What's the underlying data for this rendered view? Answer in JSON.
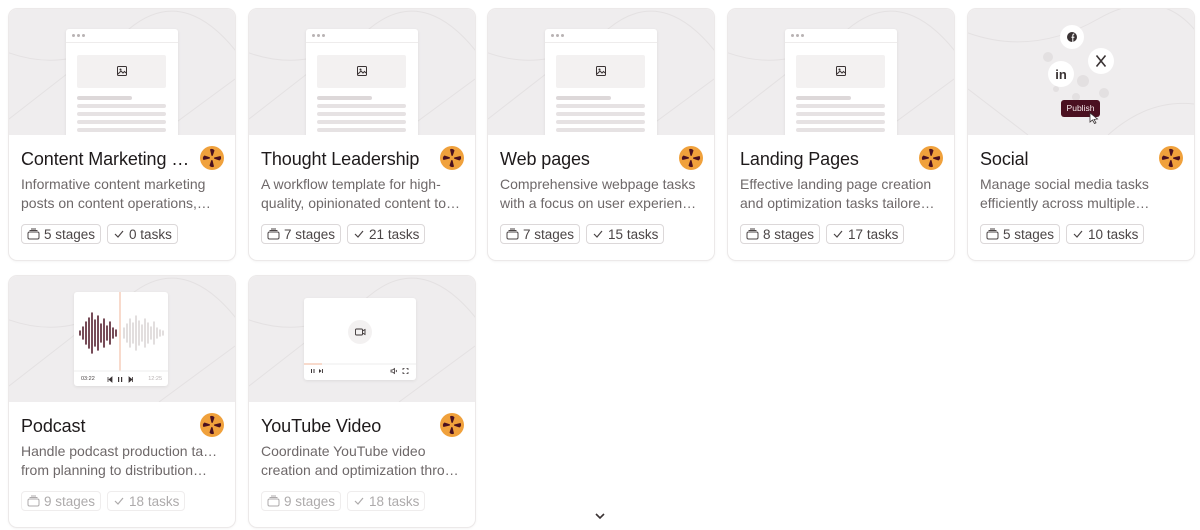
{
  "cards": [
    {
      "title": "Content Marketing …",
      "desc": [
        "Informative content marketing",
        "posts on content operations,…"
      ],
      "stages": "5 stages",
      "tasks": "0 tasks",
      "thumb": "document"
    },
    {
      "title": "Thought Leadership",
      "desc": [
        "A workflow template for high-",
        "quality, opinionated content to…"
      ],
      "stages": "7 stages",
      "tasks": "21 tasks",
      "thumb": "document"
    },
    {
      "title": "Web pages",
      "desc": [
        "Comprehensive webpage tasks",
        "with a focus on user experience…"
      ],
      "stages": "7 stages",
      "tasks": "15 tasks",
      "thumb": "document"
    },
    {
      "title": "Landing Pages",
      "desc": [
        "Effective landing page creation",
        "and optimization tasks tailored f…"
      ],
      "stages": "8 stages",
      "tasks": "17 tasks",
      "thumb": "document"
    },
    {
      "title": "Social",
      "desc": [
        "Manage social media tasks",
        "efficiently across multiple…"
      ],
      "stages": "5 stages",
      "tasks": "10 tasks",
      "thumb": "social",
      "publish_label": "Publish"
    },
    {
      "title": "Podcast",
      "desc": [
        "Handle podcast production tasks",
        "from planning to distribution…"
      ],
      "stages": "9 stages",
      "tasks": "18 tasks",
      "thumb": "podcast",
      "time_start": "03:22",
      "time_end": "12:25"
    },
    {
      "title": "YouTube Video",
      "desc": [
        "Coordinate YouTube video",
        "creation and optimization throu…"
      ],
      "stages": "9 stages",
      "tasks": "18 tasks",
      "thumb": "video"
    }
  ],
  "icons": {
    "stages": "stack-icon",
    "tasks": "check-icon",
    "logo": "brand-flower-icon",
    "scroll": "chevron-down-icon"
  },
  "colors": {
    "logo_bg": "#f0a13c",
    "logo_fg": "#4a1020",
    "publish_bg": "#4a1020",
    "accent_line": "#f2b49a"
  }
}
